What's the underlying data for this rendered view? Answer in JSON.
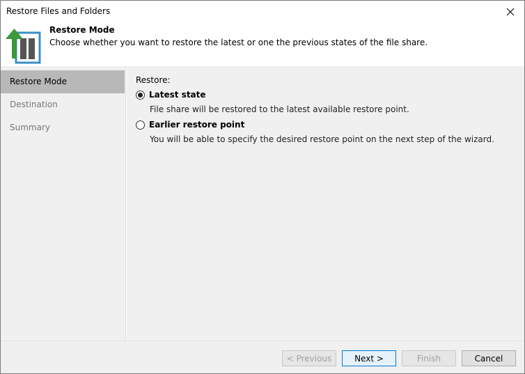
{
  "window": {
    "title": "Restore Files and Folders"
  },
  "header": {
    "step_title": "Restore Mode",
    "step_description": "Choose whether you want to restore the latest or one the previous states of the file share."
  },
  "sidebar": {
    "items": [
      {
        "label": "Restore Mode",
        "active": true
      },
      {
        "label": "Destination",
        "active": false
      },
      {
        "label": "Summary",
        "active": false
      }
    ]
  },
  "content": {
    "restore_label": "Restore:",
    "options": [
      {
        "label": "Latest state",
        "description": "File share will be restored to the latest available restore point.",
        "selected": true
      },
      {
        "label": "Earlier restore point",
        "description": "You will be able to specify the desired restore point on the next step of the wizard.",
        "selected": false
      }
    ]
  },
  "footer": {
    "previous_label": "< Previous",
    "next_label": "Next >",
    "finish_label": "Finish",
    "cancel_label": "Cancel"
  },
  "colors": {
    "accent_green": "#3a9a3a",
    "logo_blue": "#3a8fc6",
    "selected_nav": "#b8b8b8",
    "panel_bg": "#f0f0f0"
  }
}
